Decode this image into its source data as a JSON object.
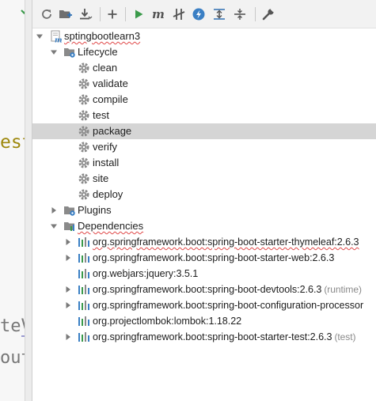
{
  "toolbar": {
    "buttons": [
      {
        "name": "reimport-icon"
      },
      {
        "name": "add-project-icon"
      },
      {
        "name": "download-icon"
      },
      {
        "name": "plus-icon"
      },
      {
        "name": "run-icon"
      },
      {
        "name": "maven-goal-icon"
      },
      {
        "name": "toggle-offline-icon"
      },
      {
        "name": "skip-tests-icon"
      },
      {
        "name": "show-dependencies-icon"
      },
      {
        "name": "collapse-all-icon"
      },
      {
        "name": "settings-wrench-icon"
      }
    ]
  },
  "project": {
    "name": "sptingbootlearn3",
    "lifecycle": {
      "label": "Lifecycle",
      "goals": [
        "clean",
        "validate",
        "compile",
        "test",
        "package",
        "verify",
        "install",
        "site",
        "deploy"
      ],
      "selected": "package"
    },
    "plugins_label": "Plugins",
    "dependencies": {
      "label": "Dependencies",
      "items": [
        {
          "text": "org.springframework.boot:spring-boot-starter-thymeleaf:2.6.3",
          "suffix": "",
          "expandable": true,
          "error": true
        },
        {
          "text": "org.springframework.boot:spring-boot-starter-web:2.6.3",
          "suffix": "",
          "expandable": true,
          "error": false
        },
        {
          "text": "org.webjars:jquery:3.5.1",
          "suffix": "",
          "expandable": false,
          "error": false
        },
        {
          "text": "org.springframework.boot:spring-boot-devtools:2.6.3",
          "suffix": "(runtime)",
          "expandable": true,
          "error": false
        },
        {
          "text": "org.springframework.boot:spring-boot-configuration-processor",
          "suffix": "",
          "expandable": true,
          "error": false
        },
        {
          "text": "org.projectlombok:lombok:1.18.22",
          "suffix": "",
          "expandable": false,
          "error": false
        },
        {
          "text": "org.springframework.boot:spring-boot-starter-test:2.6.3",
          "suffix": "(test)",
          "expandable": true,
          "error": false
        }
      ]
    }
  },
  "editor_fragments": {
    "line1": "est",
    "line2": "teVa",
    "line3": "oute"
  },
  "colors": {
    "accent_green": "#3a9a4a",
    "selection": "#d5d5d5",
    "icon_blue": "#3a7fc4",
    "icon_gray": "#6f6f6f",
    "keyword_gold": "#9e880d"
  }
}
